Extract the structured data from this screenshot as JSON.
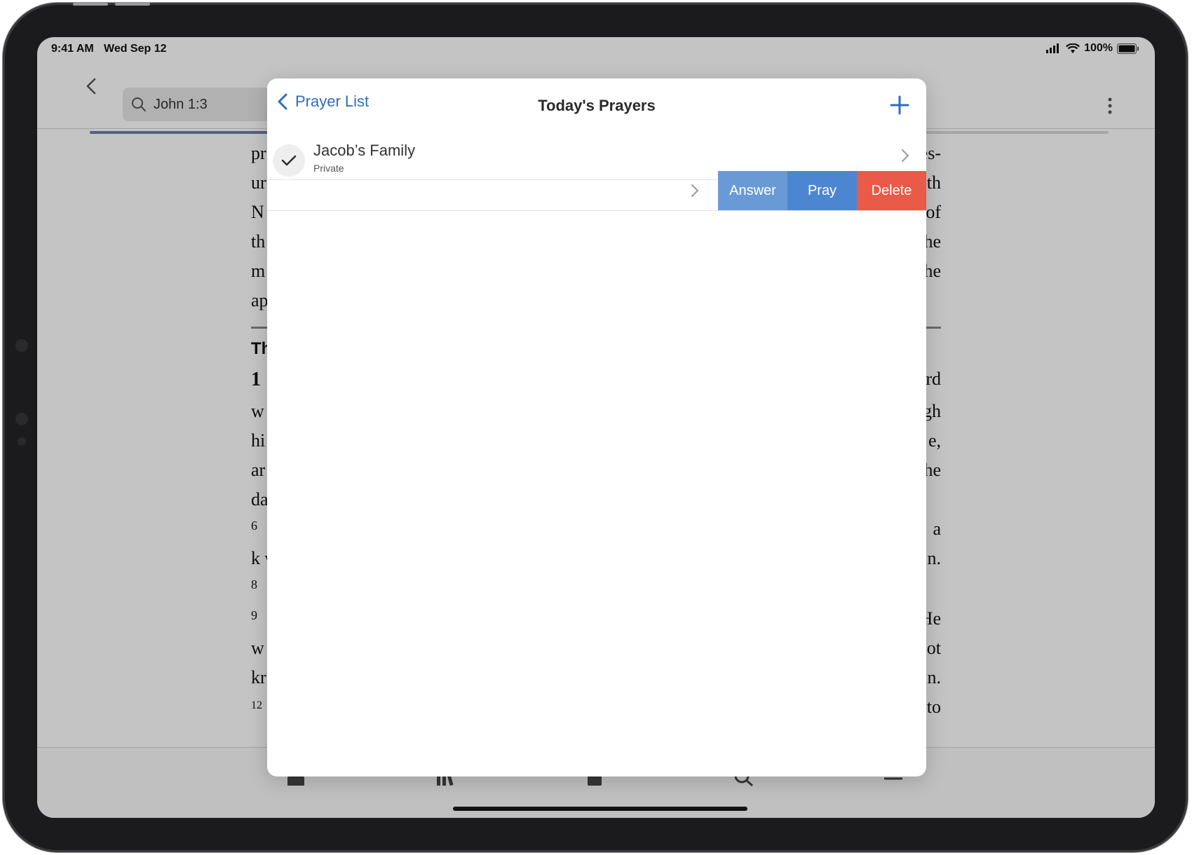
{
  "status_bar": {
    "time": "9:41 AM",
    "date": "Wed Sep 12",
    "battery": "100%"
  },
  "nav": {
    "search_text": "John 1:3",
    "progress": 0.78
  },
  "reader": {
    "left_fragments": [
      "pr",
      "ur",
      "N",
      "th",
      "m",
      "ap",
      "Th",
      "1",
      "w",
      "hi",
      "ar",
      "da",
      "6",
      "k w",
      "8",
      "9",
      "w",
      "kr",
      "12"
    ],
    "right_fragments": [
      "es-",
      "th",
      "of",
      "he",
      "he",
      "rd",
      "gh",
      "e,",
      "he",
      "a",
      "n.",
      "He",
      "ot",
      "n.",
      "to"
    ]
  },
  "modal": {
    "back_label": "Prayer List",
    "title": "Today's Prayers",
    "rows": [
      {
        "title": "Jacob’s Family",
        "subtitle": "Private"
      }
    ],
    "actions": {
      "answer": "Answer",
      "pray": "Pray",
      "delete": "Delete"
    }
  },
  "icons": {
    "back": "chevron-left-icon",
    "search": "search-icon",
    "add": "plus-icon",
    "check": "checkmark-icon",
    "chevron": "chevron-right-icon",
    "more": "more-vertical-icon"
  },
  "colors": {
    "accent": "#2f6cc0",
    "answer": "#6a9ad6",
    "pray": "#4d86d0",
    "delete": "#e95a48"
  }
}
